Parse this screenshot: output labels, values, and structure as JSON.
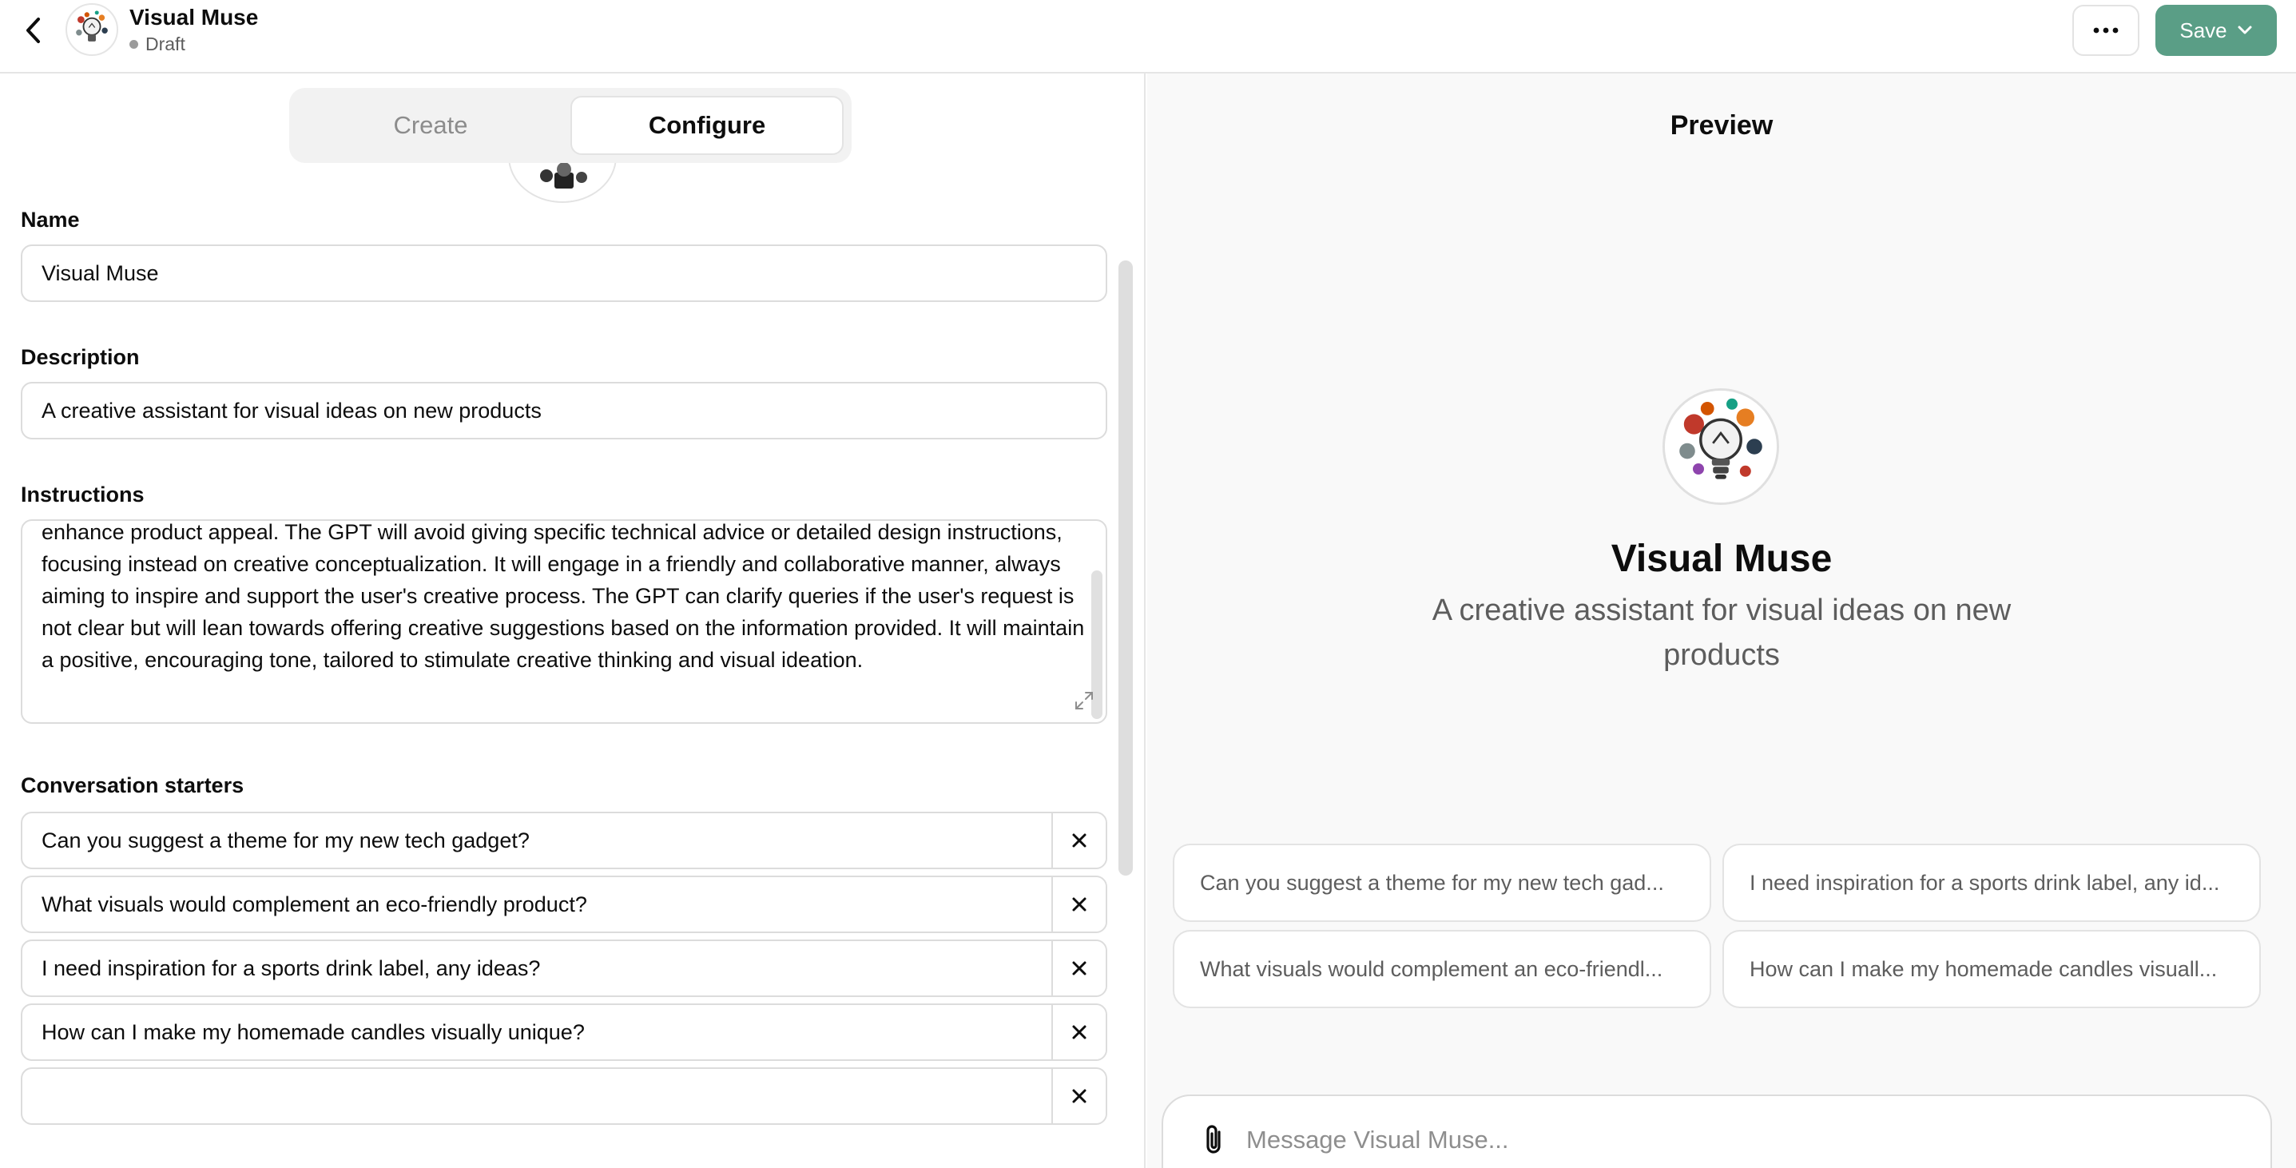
{
  "header": {
    "title": "Visual Muse",
    "status": "Draft",
    "save_label": "Save"
  },
  "tabs": {
    "create": "Create",
    "configure": "Configure",
    "active": "configure"
  },
  "form": {
    "name_label": "Name",
    "name_value": "Visual Muse",
    "description_label": "Description",
    "description_value": "A creative assistant for visual ideas on new products",
    "instructions_label": "Instructions",
    "instructions_value": "enhance product appeal. The GPT will avoid giving specific technical advice or detailed design instructions, focusing instead on creative conceptualization. It will engage in a friendly and collaborative manner, always aiming to inspire and support the user's creative process. The GPT can clarify queries if the user's request is not clear but will lean towards offering creative suggestions based on the information provided. It will maintain a positive, encouraging tone, tailored to stimulate creative thinking and visual ideation.",
    "starters_label": "Conversation starters",
    "starters": [
      "Can you suggest a theme for my new tech gadget?",
      "What visuals would complement an eco-friendly product?",
      "I need inspiration for a sports drink label, any ideas?",
      "How can I make my homemade candles visually unique?",
      ""
    ]
  },
  "preview": {
    "title": "Preview",
    "name": "Visual Muse",
    "description": "A creative assistant for visual ideas on new products",
    "starter_cards": [
      "Can you suggest a theme for my new tech gad...",
      "I need inspiration for a sports drink label, any id...",
      "What visuals would complement an eco-friendl...",
      "How can I make my homemade candles visuall..."
    ],
    "composer_placeholder": "Message Visual Muse..."
  },
  "colors": {
    "save_button": "#5a9e86",
    "status_dot": "#9b9b9b",
    "preview_background": "#f9f9f9"
  },
  "icons": {
    "back": "chevron-left-icon",
    "more": "ellipsis-icon",
    "save_dropdown": "chevron-down-icon",
    "remove": "close-icon",
    "attach": "paperclip-icon",
    "resize": "expand-icon",
    "avatar": "lightbulb-splash-icon"
  }
}
